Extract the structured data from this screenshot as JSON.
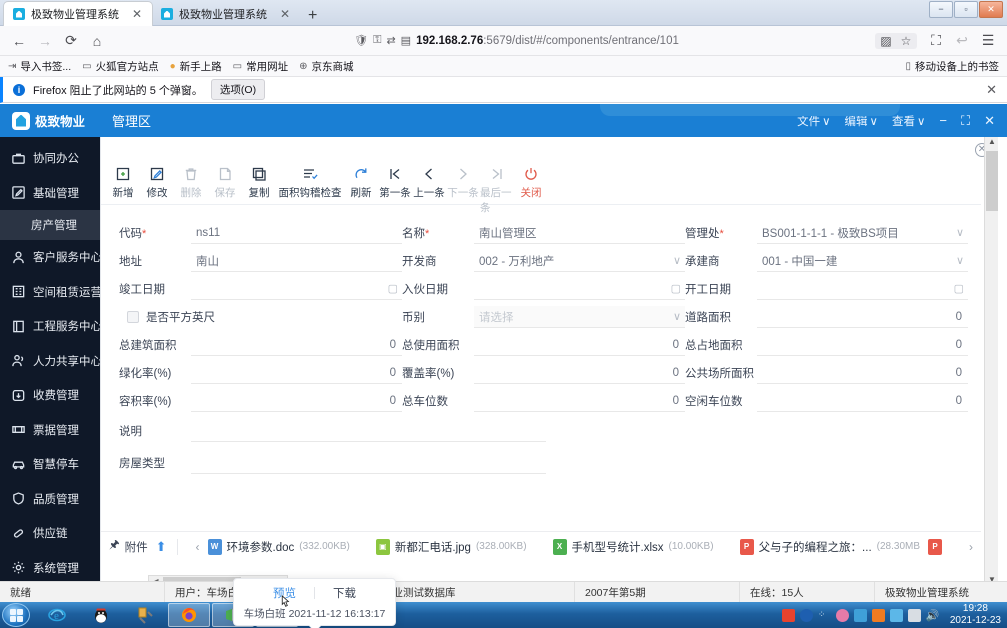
{
  "browser": {
    "tabs": [
      {
        "title": "极致物业管理系统",
        "active": true,
        "close": "✕"
      },
      {
        "title": "极致物业管理系统",
        "active": false,
        "close": "✕"
      }
    ],
    "newtab_label": "+",
    "nav": {
      "back": "←",
      "forward": "→",
      "reload": "⟳",
      "home": "⌂"
    },
    "url": {
      "host": "192.168.2.76",
      "path": ":5679/dist/#/components/entrance/101"
    },
    "url_icons": {
      "shield": "🛡",
      "permission": "⚿",
      "reader": "⇄",
      "flip": "▤"
    },
    "url_right": {
      "qr": "▨",
      "bookmark": "☆"
    },
    "toolbar_right": {
      "screenshot": "⛶",
      "sync": "↩",
      "menu": "☰"
    },
    "bookmarks": [
      {
        "label": "导入书签...",
        "icon": "⇥"
      },
      {
        "label": "火狐官方站点",
        "icon": "▭"
      },
      {
        "label": "新手上路",
        "icon": "●"
      },
      {
        "label": "常用网址",
        "icon": "▭"
      },
      {
        "label": "京东商城",
        "icon": "⊕"
      }
    ],
    "bookmarks_right": {
      "label": "移动设备上的书签",
      "icon": "▯"
    },
    "notification": {
      "badge": "i",
      "text": "Firefox 阻止了此网站的 5 个弹窗。",
      "button": "选项(O)",
      "close": "✕"
    },
    "window_buttons": {
      "minimize": "−",
      "maximize": "▫",
      "close": "✕"
    }
  },
  "app": {
    "brand": "极致物业",
    "page_title": "管理区",
    "menus": [
      {
        "label": "文件",
        "caret": "∨"
      },
      {
        "label": "编辑",
        "caret": "∨"
      },
      {
        "label": "查看",
        "caret": "∨"
      }
    ],
    "window_controls": {
      "minimize": "−",
      "maximize": "⛶",
      "close": "✕"
    },
    "inner_close": "✕"
  },
  "sidebar": {
    "items": [
      {
        "label": "协同办公",
        "icon": "briefcase-icon",
        "sub": false
      },
      {
        "label": "基础管理",
        "icon": "edit-square-icon",
        "sub": false
      },
      {
        "label": "房产管理",
        "icon": "",
        "sub": true,
        "active": true
      },
      {
        "label": "客户服务中心",
        "icon": "user-icon",
        "sub": false
      },
      {
        "label": "空间租赁运营",
        "icon": "building-icon",
        "sub": false
      },
      {
        "label": "工程服务中心",
        "icon": "book-icon",
        "sub": false
      },
      {
        "label": "人力共享中心",
        "icon": "users-icon",
        "sub": false
      },
      {
        "label": "收费管理",
        "icon": "download-icon",
        "sub": false
      },
      {
        "label": "票据管理",
        "icon": "ticket-icon",
        "sub": false
      },
      {
        "label": "智慧停车",
        "icon": "car-icon",
        "sub": false
      },
      {
        "label": "品质管理",
        "icon": "shield-icon",
        "sub": false
      },
      {
        "label": "供应链",
        "icon": "link-icon",
        "sub": false
      },
      {
        "label": "系统管理",
        "icon": "gear-icon",
        "sub": false
      }
    ]
  },
  "toolbar": {
    "items": [
      {
        "label": "新增",
        "icon": "add-icon",
        "state": "enabled"
      },
      {
        "label": "修改",
        "icon": "edit-icon",
        "state": "enabled"
      },
      {
        "label": "删除",
        "icon": "trash-icon",
        "state": "disabled"
      },
      {
        "label": "保存",
        "icon": "save-icon",
        "state": "disabled"
      },
      {
        "label": "复制",
        "icon": "copy-icon",
        "state": "enabled"
      },
      {
        "label": "面积钩稽检查",
        "icon": "checklist-icon",
        "state": "enabled",
        "wide": true
      },
      {
        "label": "刷新",
        "icon": "refresh-icon",
        "state": "enabled"
      },
      {
        "label": "第一条",
        "icon": "first-icon",
        "state": "enabled"
      },
      {
        "label": "上一条",
        "icon": "prev-icon",
        "state": "enabled"
      },
      {
        "label": "下一条",
        "icon": "next-icon",
        "state": "disabled"
      },
      {
        "label": "最后一条",
        "icon": "last-icon",
        "state": "disabled"
      },
      {
        "label": "关闭",
        "icon": "power-icon",
        "state": "danger"
      }
    ]
  },
  "form": {
    "rows": [
      {
        "c1": {
          "label": "代码",
          "required": true,
          "value": "ns11",
          "type": "text"
        },
        "c2": {
          "label": "名称",
          "required": true,
          "value": "南山管理区",
          "type": "text"
        },
        "c3": {
          "label": "管理处",
          "required": true,
          "value": "BS001-1-1-1 - 极致BS项目",
          "type": "select"
        }
      },
      {
        "c1": {
          "label": "地址",
          "required": false,
          "value": "南山",
          "type": "text"
        },
        "c2": {
          "label": "开发商",
          "required": false,
          "value": "002 - 万利地产",
          "type": "select"
        },
        "c3": {
          "label": "承建商",
          "required": false,
          "value": "001 - 中国一建",
          "type": "select"
        }
      },
      {
        "c1": {
          "label": "竣工日期",
          "required": false,
          "value": "",
          "type": "date"
        },
        "c2": {
          "label": "入伙日期",
          "required": false,
          "value": "",
          "type": "date"
        },
        "c3": {
          "label": "开工日期",
          "required": false,
          "value": "",
          "type": "date"
        }
      },
      {
        "c1": {
          "label": "是否平方英尺",
          "required": false,
          "value": "",
          "type": "checkbox",
          "checked": false
        },
        "c2": {
          "label": "币别",
          "required": false,
          "value": "",
          "placeholder": "请选择",
          "type": "select"
        },
        "c3": {
          "label": "道路面积",
          "required": false,
          "value": "0",
          "type": "number"
        }
      },
      {
        "c1": {
          "label": "总建筑面积",
          "required": false,
          "value": "0",
          "type": "number"
        },
        "c2": {
          "label": "总使用面积",
          "required": false,
          "value": "0",
          "type": "number"
        },
        "c3": {
          "label": "总占地面积",
          "required": false,
          "value": "0",
          "type": "number"
        }
      },
      {
        "c1": {
          "label": "绿化率(%)",
          "required": false,
          "value": "0",
          "type": "number"
        },
        "c2": {
          "label": "覆盖率(%)",
          "required": false,
          "value": "0",
          "type": "number"
        },
        "c3": {
          "label": "公共场所面积",
          "required": false,
          "value": "0",
          "type": "number"
        }
      },
      {
        "c1": {
          "label": "容积率(%)",
          "required": false,
          "value": "0",
          "type": "number"
        },
        "c2": {
          "label": "总车位数",
          "required": false,
          "value": "0",
          "type": "number"
        },
        "c3": {
          "label": "空闲车位数",
          "required": false,
          "value": "0",
          "type": "number"
        }
      }
    ],
    "extra": [
      {
        "label": "说明",
        "value": "",
        "type": "text"
      },
      {
        "label": "房屋类型",
        "value": "",
        "type": "text"
      }
    ]
  },
  "attachments": {
    "label": "附件",
    "upload_icon": "upload-icon",
    "prev_arrow": "‹",
    "next_arrow": "›",
    "files": [
      {
        "name": "环境参数",
        "ext": ".doc",
        "size": "(332.00KB)",
        "color": "#4a90d9",
        "glyph": "W"
      },
      {
        "name": "新都汇电话",
        "ext": ".jpg",
        "size": "(328.00KB)",
        "color": "#8cc63f",
        "glyph": "▣"
      },
      {
        "name": "手机型号统计",
        "ext": ".xlsx",
        "size": "(10.00KB)",
        "color": "#4caf50",
        "glyph": "X"
      },
      {
        "name": "父与子的编程之旅：...",
        "ext": "",
        "size": "(28.30MB",
        "color": "#e8584a",
        "glyph": "P"
      },
      {
        "name": "",
        "ext": "",
        "size": "",
        "color": "#e8584a",
        "glyph": "P"
      }
    ]
  },
  "popup": {
    "preview": "预览",
    "download": "下载",
    "meta": "车场白班  2021-11-12 16:13:17"
  },
  "statusbar": {
    "cells": [
      "就绪",
      "用户：车场白班",
      "数据库：物业测试数据库",
      "2007年第5期",
      "在线：15人",
      "极致物业管理系统"
    ]
  },
  "taskbar": {
    "start": "start-button",
    "apps": [
      {
        "name": "internet-explorer-icon",
        "open": false
      },
      {
        "name": "qq-icon",
        "open": false
      },
      {
        "name": "tool-icon",
        "open": false
      },
      {
        "name": "firefox-icon",
        "open": true
      },
      {
        "name": "network-icon",
        "open": true
      },
      {
        "name": "notepad-icon",
        "open": true
      }
    ],
    "tray": [
      "sogou-icon",
      "help-icon",
      "dots-icon",
      "flower-icon",
      "paint-icon",
      "flame-icon",
      "screen-icon",
      "battery-icon",
      "volume-icon"
    ],
    "time": "19:28",
    "date": "2021-12-23"
  }
}
